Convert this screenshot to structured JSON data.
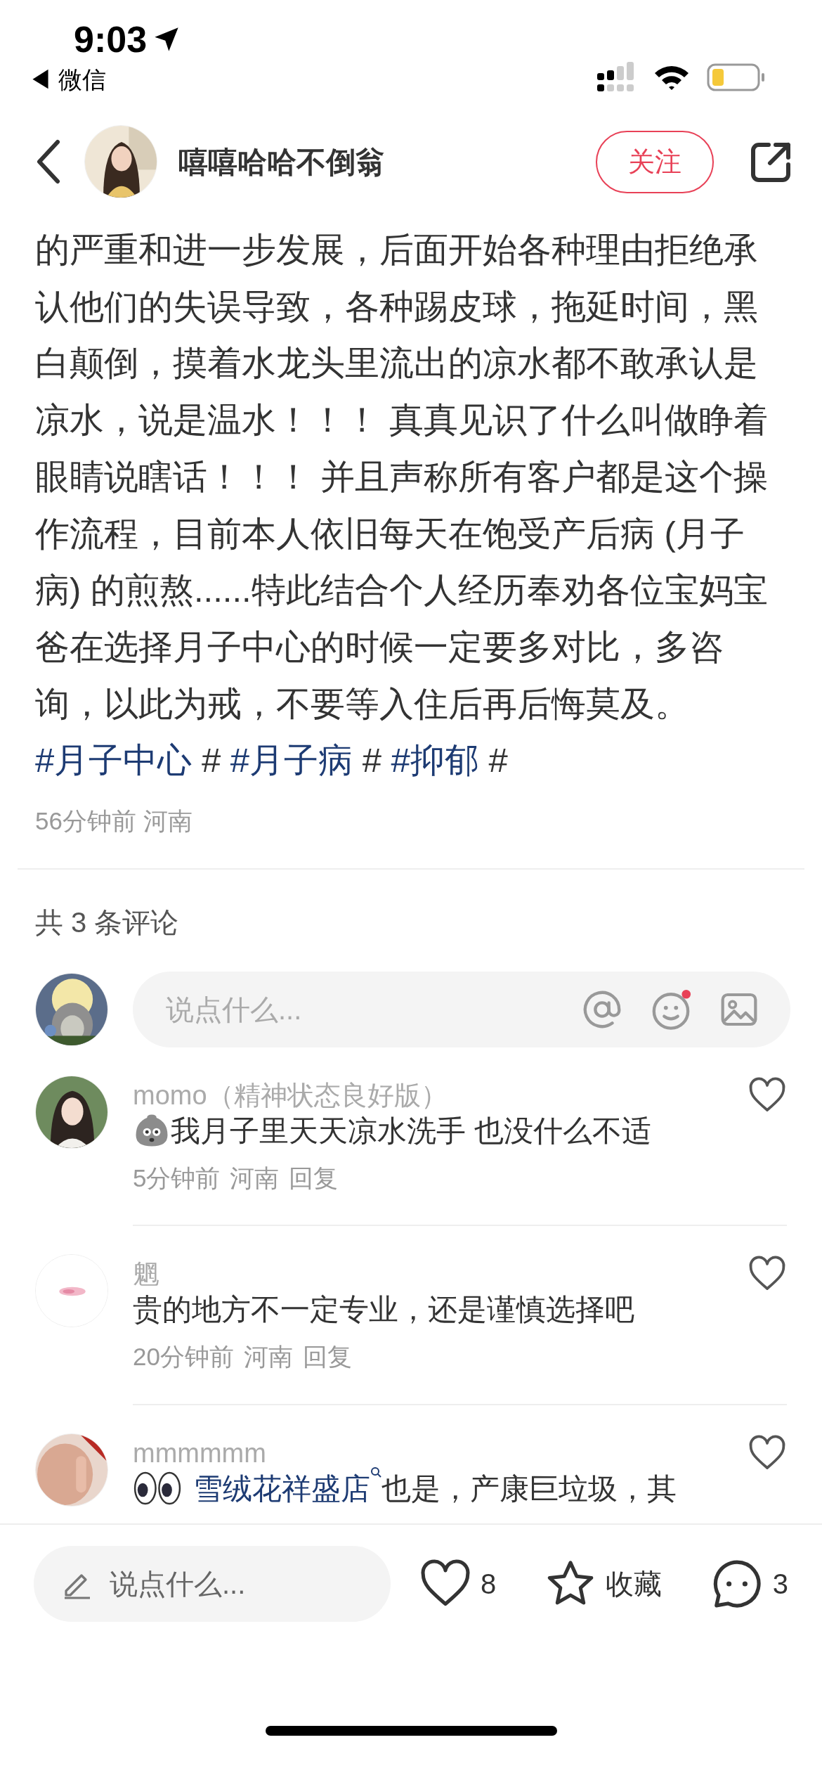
{
  "status_bar": {
    "time": "9:03",
    "back_app": "◀ 微信"
  },
  "header": {
    "author": "嘻嘻哈哈不倒翁",
    "follow_button": "关注"
  },
  "post": {
    "segments": [
      {
        "kind": "text",
        "text": "的严重和进一步发展，后面开始各种理由拒绝承认他们的失误导致，各种踢皮球，拖延时间，黑白颠倒，摸着水龙头里流出的凉水都不敢承认是凉水，说是温水！！！ 真真见识了什么叫做睁着眼睛说瞎话！！！ 并且声称所有客户都是这个操作流程，目前本人依旧每天在饱受产后病 (月子病) 的煎熬......特此结合个人经历奉劝各位宝妈宝爸在选择月子中心的时候一定要多对比，多咨询，以此为戒，不要等入住后再后悔莫及。 "
      },
      {
        "kind": "tag",
        "text": "#月子中心"
      },
      {
        "kind": "text",
        "text": " # "
      },
      {
        "kind": "tag",
        "text": "#月子病"
      },
      {
        "kind": "text",
        "text": " # "
      },
      {
        "kind": "tag",
        "text": "#抑郁"
      },
      {
        "kind": "text",
        "text": " #"
      }
    ],
    "meta": "56分钟前 河南"
  },
  "comment_count": "共 3 条评论",
  "comment_input": {
    "placeholder": "说点什么...",
    "emoji_dot": true
  },
  "comments": [
    {
      "name": "momo（精神状态良好版）",
      "liked": false,
      "segments": [
        {
          "kind": "sticker"
        },
        {
          "kind": "text",
          "text": "我月子里天天凉水洗手  也没什么不适"
        }
      ],
      "time": "5分钟前",
      "location": "河南",
      "reply": "回复"
    },
    {
      "name": "魍",
      "liked": false,
      "segments": [
        {
          "kind": "text",
          "text": "贵的地方不一定专业，还是谨慎选择吧"
        }
      ],
      "time": "20分钟前",
      "location": "河南",
      "reply": "回复"
    },
    {
      "name": "mmmmmm",
      "liked": false,
      "segments": [
        {
          "kind": "eyes"
        },
        {
          "kind": "link",
          "text": "雪绒花祥盛店"
        },
        {
          "kind": "text",
          "text": " 也是，产康巨垃圾，其"
        }
      ]
    }
  ],
  "bottom_bar": {
    "placeholder": "说点什么...",
    "like_count": "8",
    "favorite": "收藏",
    "comment_count": "3"
  }
}
